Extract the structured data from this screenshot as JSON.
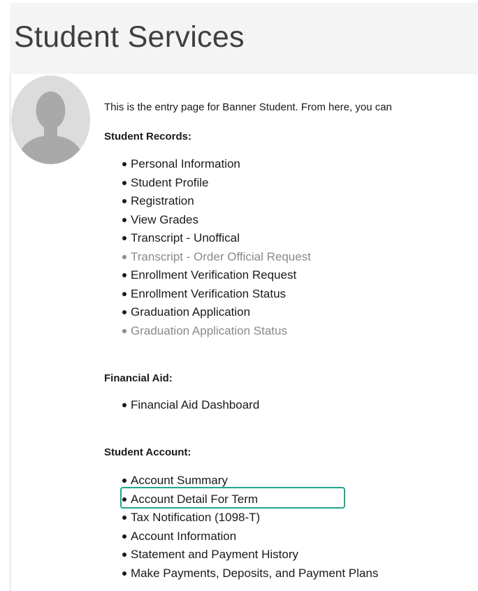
{
  "header": {
    "title": "Student Services"
  },
  "profile": {
    "avatar_icon": "user-silhouette-icon"
  },
  "intro_text": "This is the entry page for Banner Student. From here, you can",
  "sections": {
    "student_records": {
      "heading": "Student Records:",
      "items": [
        {
          "label": "Personal Information",
          "enabled": true
        },
        {
          "label": "Student Profile",
          "enabled": true
        },
        {
          "label": "Registration",
          "enabled": true
        },
        {
          "label": "View Grades",
          "enabled": true
        },
        {
          "label": "Transcript - Unoffical",
          "enabled": true
        },
        {
          "label": "Transcript - Order Official Request",
          "enabled": false
        },
        {
          "label": "Enrollment Verification Request",
          "enabled": true
        },
        {
          "label": "Enrollment Verification Status",
          "enabled": true
        },
        {
          "label": "Graduation Application",
          "enabled": true
        },
        {
          "label": "Graduation Application Status",
          "enabled": false
        }
      ]
    },
    "financial_aid": {
      "heading": "Financial Aid:",
      "items": [
        {
          "label": "Financial Aid Dashboard",
          "enabled": true
        }
      ]
    },
    "student_account": {
      "heading": "Student Account:",
      "items": [
        {
          "label": "Account Summary",
          "enabled": true
        },
        {
          "label": "Account Detail For Term",
          "enabled": true,
          "highlighted": true
        },
        {
          "label": "Tax Notification (1098-T)",
          "enabled": true
        },
        {
          "label": "Account Information",
          "enabled": true
        },
        {
          "label": "Statement and Payment History",
          "enabled": true
        },
        {
          "label": "Make Payments, Deposits, and Payment Plans",
          "enabled": true
        }
      ]
    }
  },
  "colors": {
    "highlight": "#20a68e",
    "disabled_text": "#8a8a8a",
    "header_background": "#f4f4f4"
  }
}
